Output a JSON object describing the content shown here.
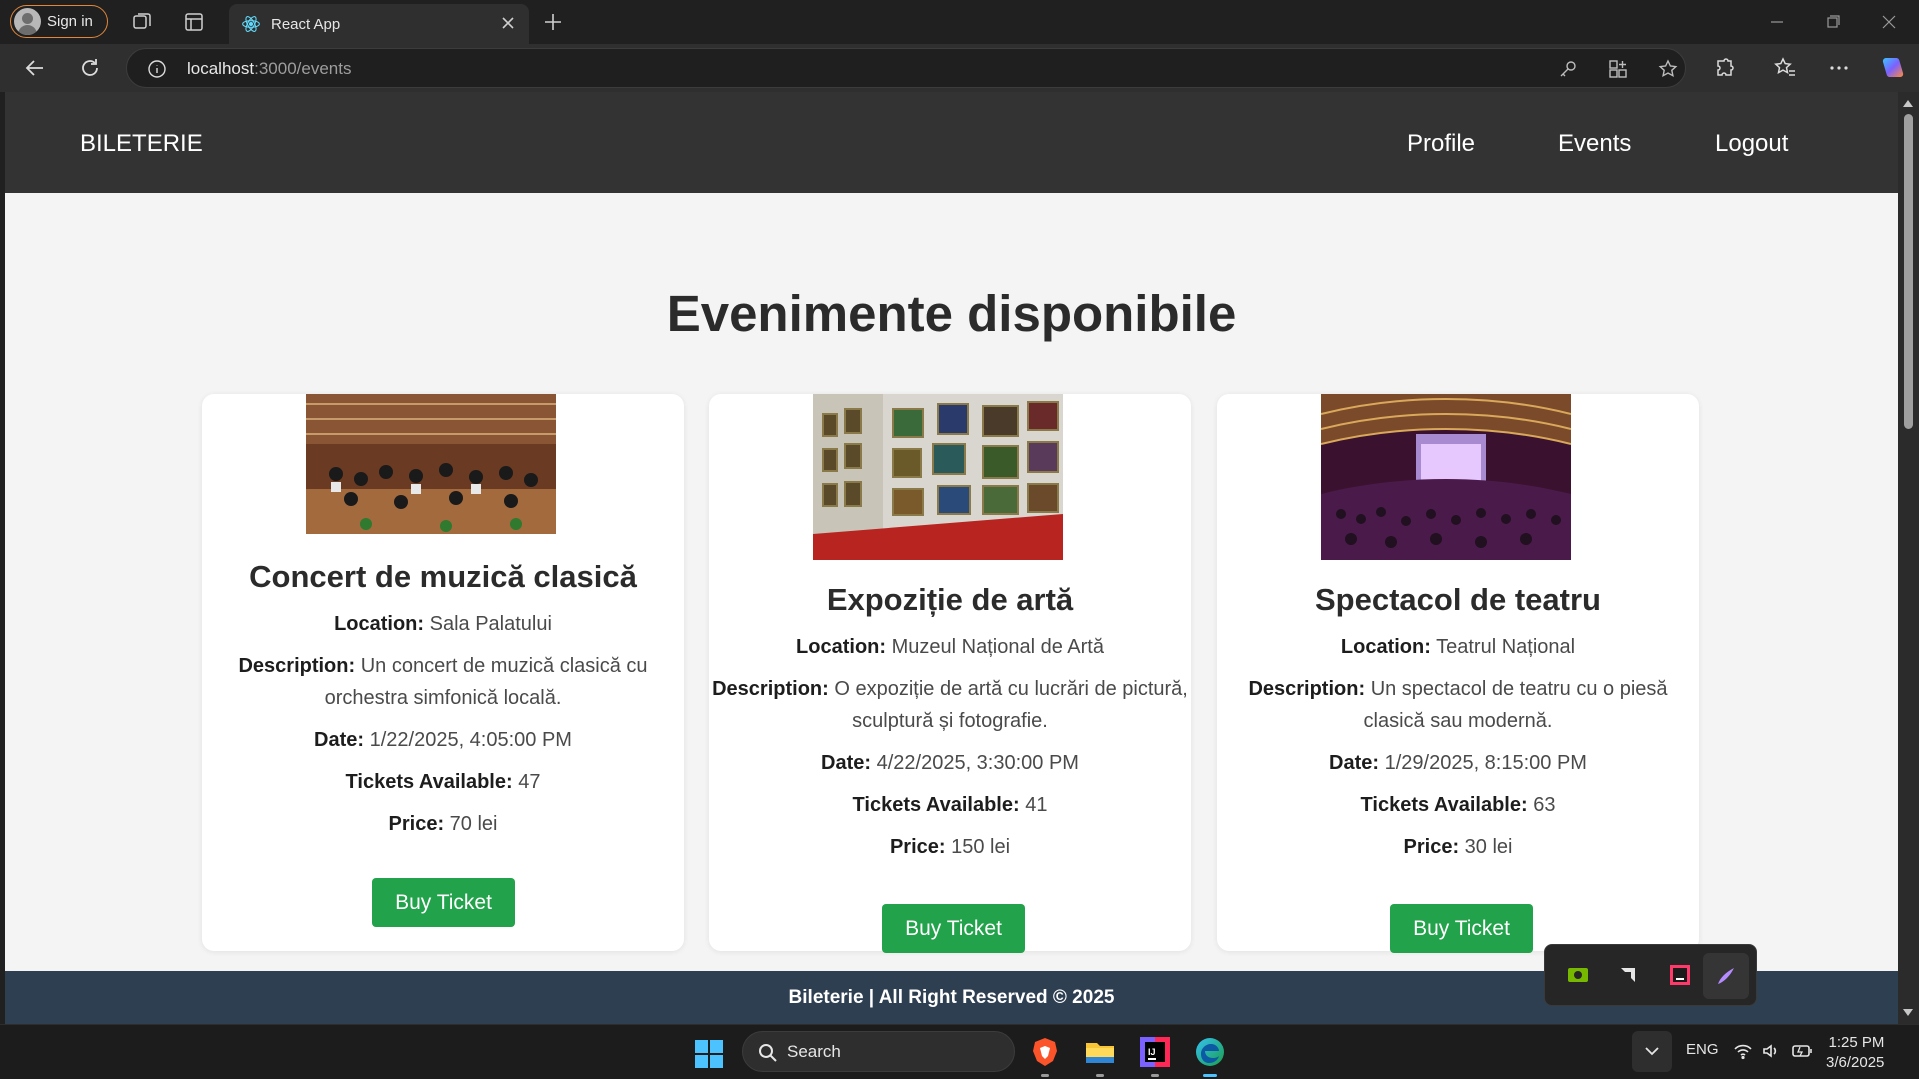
{
  "browser": {
    "signin_label": "Sign in",
    "tab_title": "React App",
    "url_host": "localhost",
    "url_path": ":3000/events"
  },
  "app": {
    "brand": "BILETERIE",
    "nav": [
      "Profile",
      "Events",
      "Logout"
    ],
    "heading": "Evenimente disponibile",
    "labels": {
      "location": "Location:",
      "description": "Description:",
      "date": "Date:",
      "tickets": "Tickets Available:",
      "price": "Price:"
    },
    "events": [
      {
        "title": "Concert de muzică clasică",
        "location": "Sala Palatului",
        "description_line1": "Un concert de muzică clasică cu",
        "description_line2": "orchestra simfonică locală.",
        "date": "1/22/2025, 4:05:00 PM",
        "tickets": "47",
        "price": "70 lei",
        "button": "Buy Ticket"
      },
      {
        "title": "Expoziție de artă",
        "location": "Muzeul Național de Artă",
        "description_line1": "O expoziție de artă cu lucrări de pictură,",
        "description_line2": "sculptură și fotografie.",
        "date": "4/22/2025, 3:30:00 PM",
        "tickets": "41",
        "price": "150 lei",
        "button": "Buy Ticket"
      },
      {
        "title": "Spectacol de teatru",
        "location": "Teatrul Național",
        "description_line1": "Un spectacol de teatru cu o piesă",
        "description_line2": "clasică sau modernă.",
        "date": "1/29/2025, 8:15:00 PM",
        "tickets": "63",
        "price": "30 lei",
        "button": "Buy Ticket"
      }
    ],
    "footer": "Bileterie | All Right Reserved © 2025"
  },
  "taskbar": {
    "search_placeholder": "Search",
    "language": "ENG",
    "time": "1:25 PM",
    "date": "3/6/2025"
  },
  "colors": {
    "navbar": "#333333",
    "footer": "#2e3f52",
    "button": "#22a24a",
    "page_bg": "#f4f4f4"
  }
}
